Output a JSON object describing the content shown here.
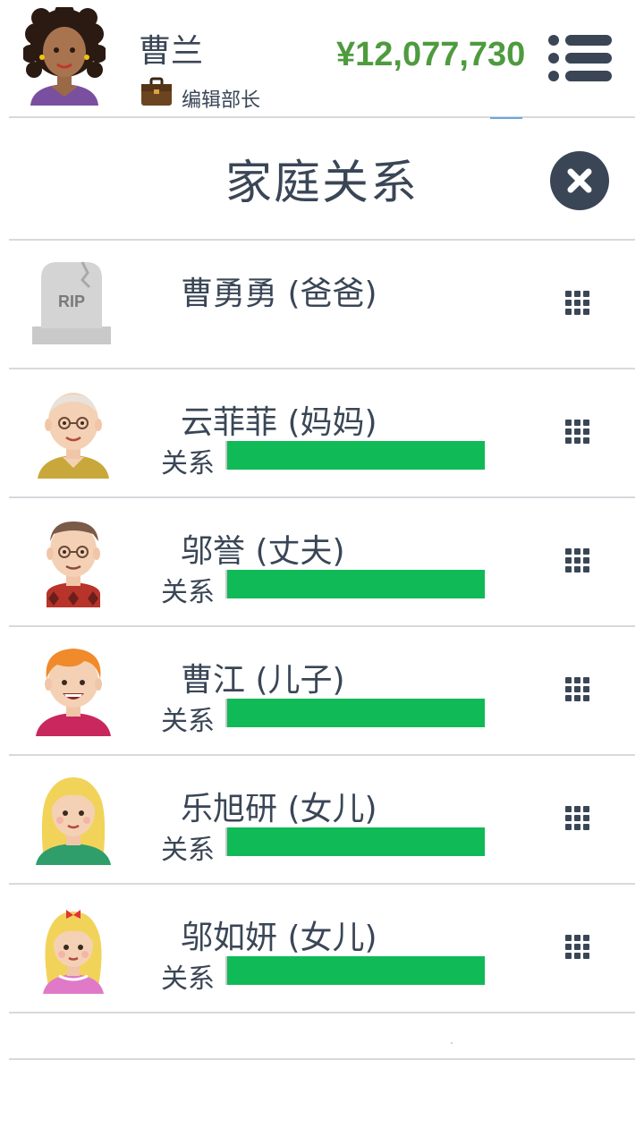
{
  "header": {
    "player_name": "曹兰",
    "job_title": "编辑部长",
    "money": "¥12,077,730",
    "avatar_icon": "woman-curly-hair-avatar",
    "job_icon": "briefcase-icon",
    "menu_icon": "hamburger-menu-icon"
  },
  "panel": {
    "title": "家庭关系",
    "close_icon": "close-icon"
  },
  "relationship_label": "关系",
  "members": [
    {
      "name": "曹勇勇 (爸爸)",
      "portrait": "tombstone-rip-icon",
      "deceased": true,
      "relationship": null
    },
    {
      "name": "云菲菲 (妈妈)",
      "portrait": "elderly-woman-avatar",
      "deceased": false,
      "relationship": 1.0
    },
    {
      "name": "邬誉 (丈夫)",
      "portrait": "elderly-man-avatar",
      "deceased": false,
      "relationship": 1.0
    },
    {
      "name": "曹江 (儿子)",
      "portrait": "boy-orange-hair-avatar",
      "deceased": false,
      "relationship": 1.0
    },
    {
      "name": "乐旭研 (女儿)",
      "portrait": "girl-blonde-hair-avatar",
      "deceased": false,
      "relationship": 1.0
    },
    {
      "name": "邬如妍 (女儿)",
      "portrait": "little-girl-pigtails-avatar",
      "deceased": false,
      "relationship": 1.0
    }
  ],
  "rip_text": "RIP",
  "colors": {
    "money": "#4e9b3f",
    "relationship_bar": "#0fba57",
    "text": "#3a4656",
    "close_button": "#3a4656"
  }
}
